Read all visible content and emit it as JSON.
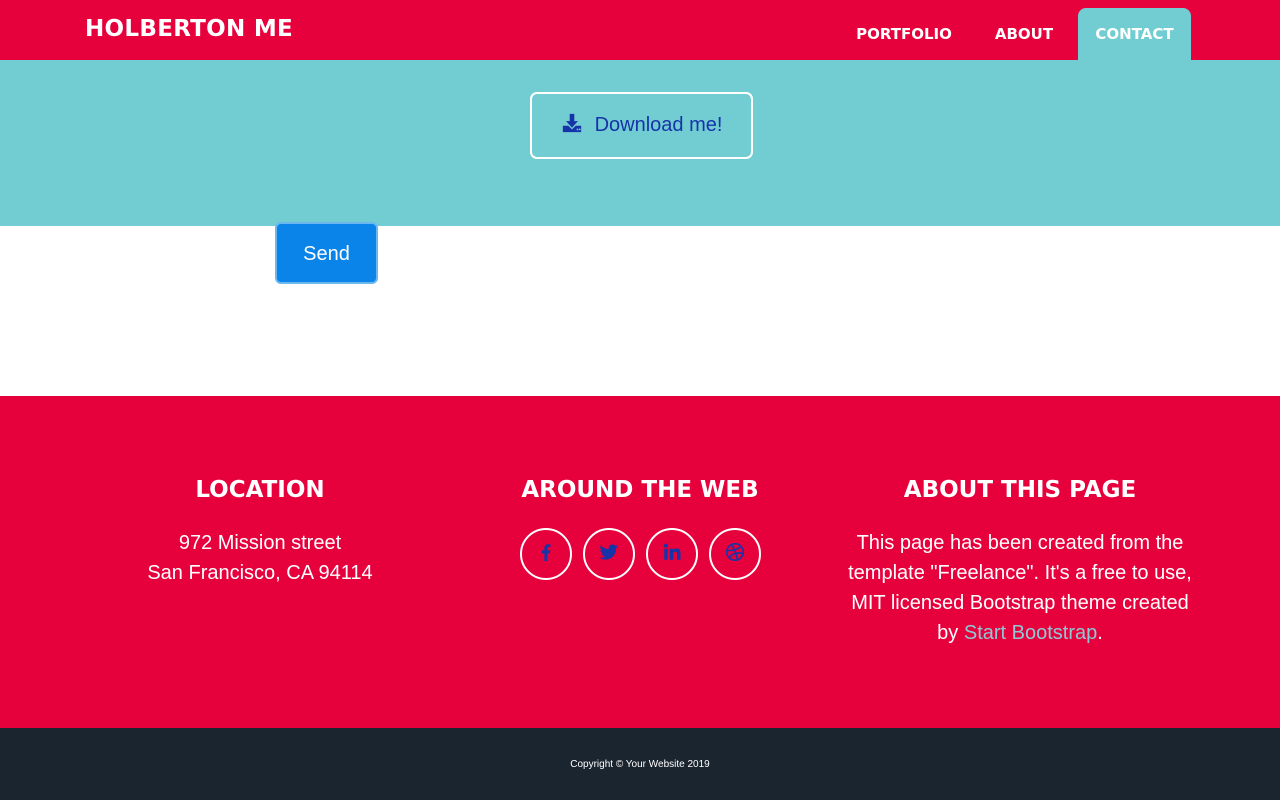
{
  "colors": {
    "primary_red": "#e6003c",
    "teal": "#72cdd3",
    "send_blue": "#0a84e8",
    "dark_footer": "#1a252f",
    "icon_blue": "#1634a8",
    "link": "#8ec9d6"
  },
  "navbar": {
    "brand": "HOLBERTON ME",
    "items": [
      {
        "label": "PORTFOLIO",
        "active": false
      },
      {
        "label": "ABOUT",
        "active": false
      },
      {
        "label": "CONTACT",
        "active": true
      }
    ]
  },
  "hero": {
    "download_label": "Download me!",
    "download_icon": "download-icon"
  },
  "contact_form": {
    "send_label": "Send"
  },
  "footer": {
    "location": {
      "title": "LOCATION",
      "line1": "972 Mission street",
      "line2": "San Francisco, CA 94114"
    },
    "web": {
      "title": "AROUND THE WEB",
      "icons": [
        "facebook-icon",
        "twitter-icon",
        "linkedin-icon",
        "dribbble-icon"
      ]
    },
    "about": {
      "title": "ABOUT THIS PAGE",
      "text_before": "This page has been created from the template \"Freelance\". It's a free to use, MIT licensed Bootstrap theme created by ",
      "link_text": "Start Bootstrap",
      "text_after": "."
    }
  },
  "copyright": "Copyright © Your Website 2019"
}
